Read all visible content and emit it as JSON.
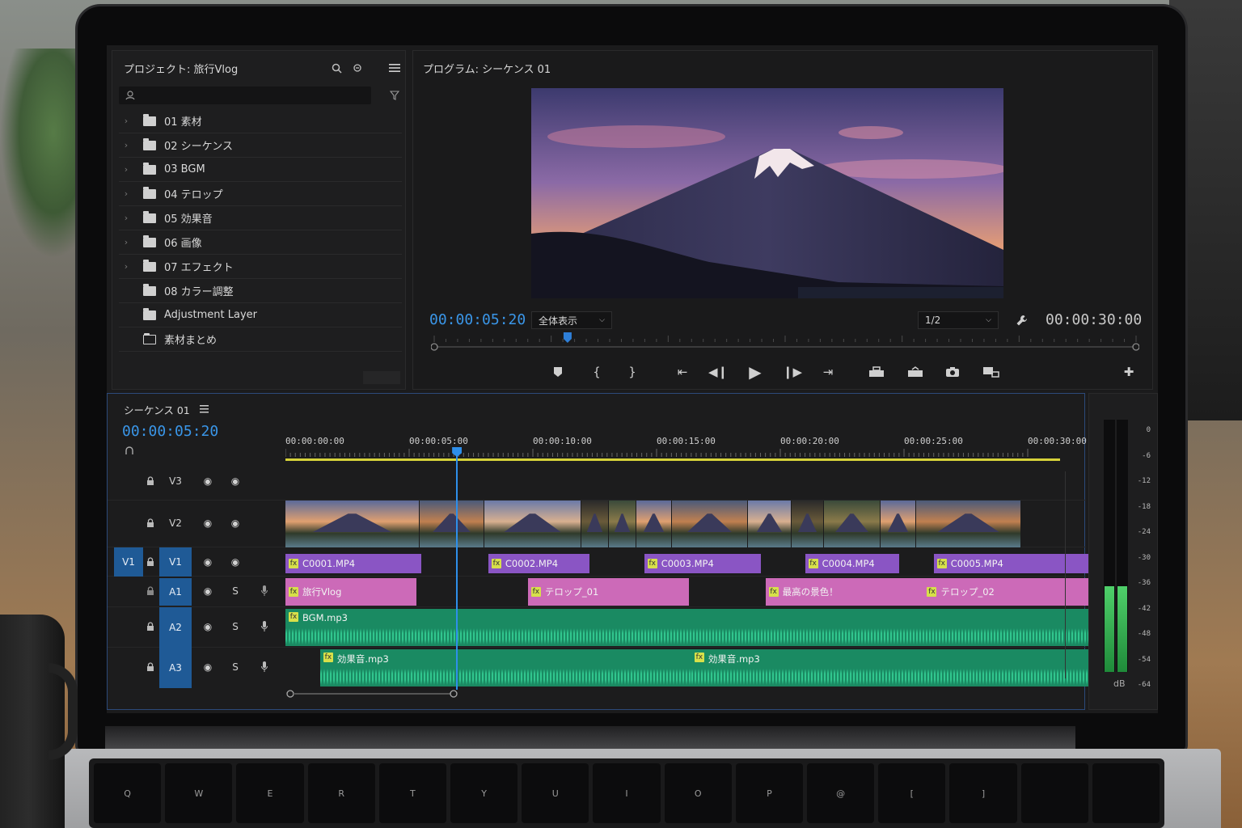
{
  "project": {
    "title": "プロジェクト: 旅行Vlog",
    "bins": [
      {
        "label": "01 素材",
        "chevron": true,
        "open": false
      },
      {
        "label": "02 シーケンス",
        "chevron": true,
        "open": false
      },
      {
        "label": "03 BGM",
        "chevron": true,
        "open": false
      },
      {
        "label": "04 テロップ",
        "chevron": true,
        "open": false
      },
      {
        "label": "05 効果音",
        "chevron": true,
        "open": false
      },
      {
        "label": "06 画像",
        "chevron": true,
        "open": false
      },
      {
        "label": "07 エフェクト",
        "chevron": true,
        "open": false
      },
      {
        "label": "08 カラー調整",
        "chevron": false,
        "open": false
      },
      {
        "label": "Adjustment Layer",
        "chevron": false,
        "open": false
      },
      {
        "label": "素材まとめ",
        "chevron": false,
        "open": true
      }
    ]
  },
  "program": {
    "title": "プログラム: シーケンス 01",
    "current_timecode": "00:00:05:20",
    "zoom": "全体表示",
    "resolution": "1/2",
    "duration_timecode": "00:00:30:00",
    "playhead_fraction": 0.19
  },
  "timeline": {
    "sequence_name": "シーケンス 01",
    "timecode": "00:00:05:20",
    "ruler": [
      "00:00:00:00",
      "00:00:05:00",
      "00:00:10:00",
      "00:00:15:00",
      "00:00:20:00",
      "00:00:25:00",
      "00:00:30:00"
    ],
    "playhead_seconds": 6.9,
    "tracks": {
      "v3": "V3",
      "v2": "V2",
      "v1_source": "V1",
      "v1": "V1",
      "a1": "A1",
      "a2": "A2",
      "a3": "A3",
      "solo": "S"
    },
    "video_clips": [
      {
        "name": "C0001.MP4",
        "start": 0,
        "end": 5.5
      },
      {
        "name": "C0002.MP4",
        "start": 8.2,
        "end": 12.3
      },
      {
        "name": "C0003.MP4",
        "start": 14.5,
        "end": 19.2
      },
      {
        "name": "C0004.MP4",
        "start": 21.0,
        "end": 24.8
      },
      {
        "name": "C0005.MP4",
        "start": 26.2,
        "end": 32.8
      }
    ],
    "title_clips": [
      {
        "name": "旅行Vlog",
        "start": 0,
        "end": 5.3
      },
      {
        "name": "テロップ_01",
        "start": 9.8,
        "end": 16.3
      },
      {
        "name": "最高の景色！",
        "start": 19.4,
        "end": 25.8
      },
      {
        "name": "テロップ_02",
        "start": 25.8,
        "end": 32.8
      }
    ],
    "audio_a2": [
      {
        "name": "BGM.mp3",
        "start": 0,
        "end": 32.8
      }
    ],
    "audio_a3": [
      {
        "name": "効果音.mp3",
        "start": 1.4,
        "end": 32.5
      },
      {
        "name": "効果音.mp3",
        "start": 16.4,
        "end": 32.5
      }
    ]
  },
  "meters": {
    "labels": [
      "0",
      "-6",
      "-12",
      "-18",
      "-24",
      "-30",
      "-36",
      "-42",
      "-48",
      "-54",
      "-64"
    ],
    "unit": "dB",
    "level_left": 0.34,
    "level_right": 0.34
  },
  "keyboard": [
    "Q",
    "W",
    "E",
    "R",
    "T",
    "Y",
    "U",
    "I",
    "O",
    "P",
    "@",
    "[",
    "]",
    "",
    ""
  ]
}
